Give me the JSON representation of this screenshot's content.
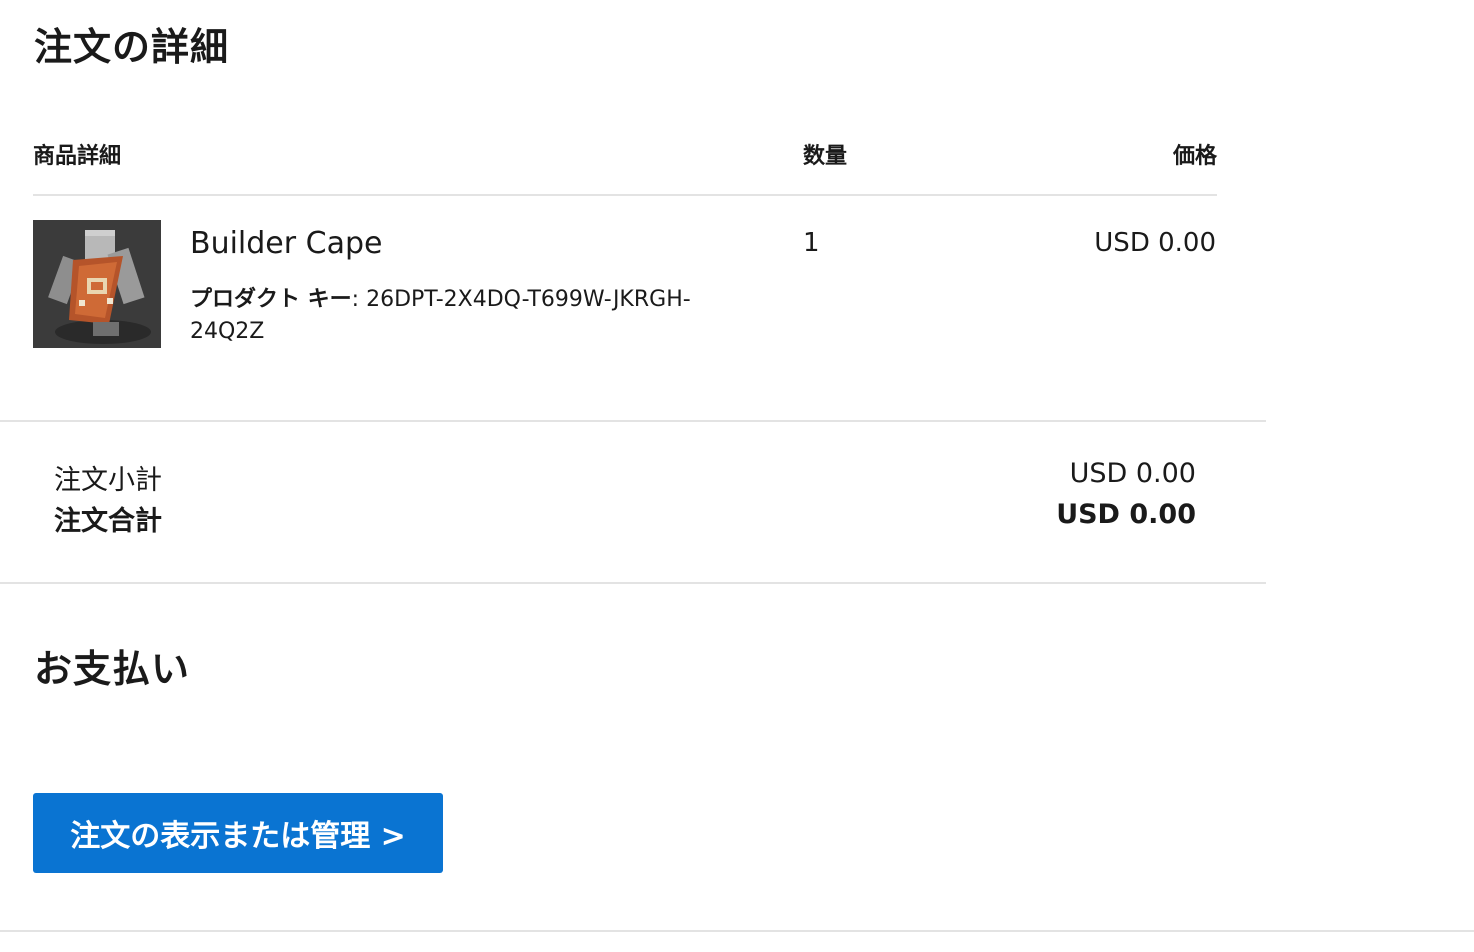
{
  "order_details_heading": "注文の詳細",
  "table": {
    "col_item": "商品詳細",
    "col_qty": "数量",
    "col_price": "価格"
  },
  "item": {
    "name": "Builder Cape",
    "key_label": "プロダクト キー",
    "key_value": ": 26DPT-2X4DQ-T699W-JKRGH-24Q2Z",
    "quantity": "1",
    "price": "USD 0.00",
    "thumbnail_icon": "builder-cape-image"
  },
  "summary": {
    "subtotal_label": "注文小計",
    "subtotal_value": "USD 0.00",
    "total_label": "注文合計",
    "total_value": "USD 0.00"
  },
  "payment_heading": "お支払い",
  "manage_button_label": "注文の表示または管理 >",
  "colors": {
    "button_bg": "#0a74d2",
    "divider": "#e3e3e3"
  }
}
